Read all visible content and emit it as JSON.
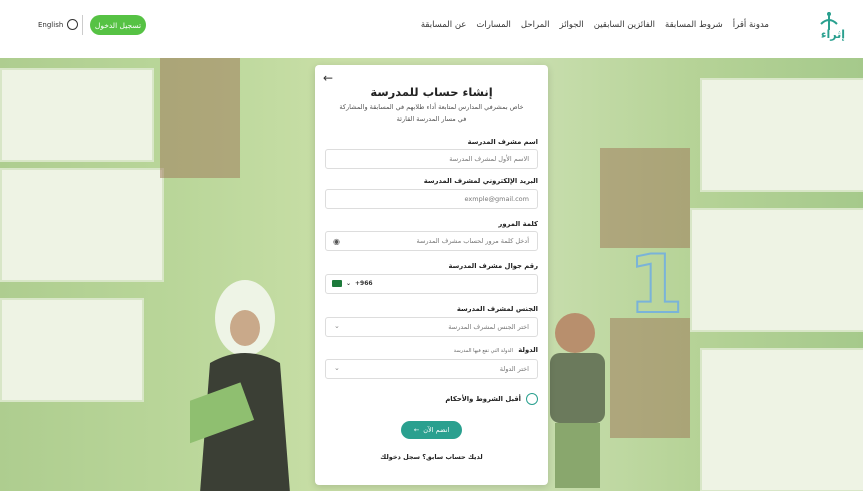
{
  "header": {
    "logo_text": "إثراء",
    "nav": [
      "عن المسابقة",
      "المسارات",
      "المراحل",
      "الجوائز",
      "الفائزين السابقين",
      "شروط المسابقة",
      "مدونة أقرأ"
    ],
    "login_label": "تسجيل الدخول",
    "language_label": "English"
  },
  "form": {
    "title": "إنشاء حساب للمدرسة",
    "subtitle": "خاص بمشرفي المدارس لمتابعة أداء طلابهم في المسابقة والمشاركة في مسار المدرسة القارئة",
    "fields": {
      "name": {
        "label": "اسم مشرف المدرسة",
        "placeholder": "الاسم الأول لمشرف المدرسة"
      },
      "email": {
        "label": "البريد الإلكتروني لمشرف المدرسة",
        "placeholder": "exmple@gmail.com"
      },
      "password": {
        "label": "كلمة المرور",
        "placeholder": "أدخل كلمة مرور لحساب مشرف المدرسة"
      },
      "phone": {
        "label": "رقم جوال مشرف المدرسة",
        "prefix": "+966"
      },
      "gender": {
        "label": "الجنس لمشرف المدرسة",
        "placeholder": "اختر الجنس لمشرف المدرسة"
      },
      "country": {
        "label": "الدولة",
        "hint": "الدولة التي تقع فيها المدرسة",
        "placeholder": "اختر الدولة"
      }
    },
    "terms_label": "أقبل  الشروط والأحكام",
    "join_label": "انضم الآن",
    "has_account": "لديك حساب سابق؟  سجل دخولك"
  },
  "colors": {
    "accent": "#2aa08f",
    "login": "#56c244"
  }
}
